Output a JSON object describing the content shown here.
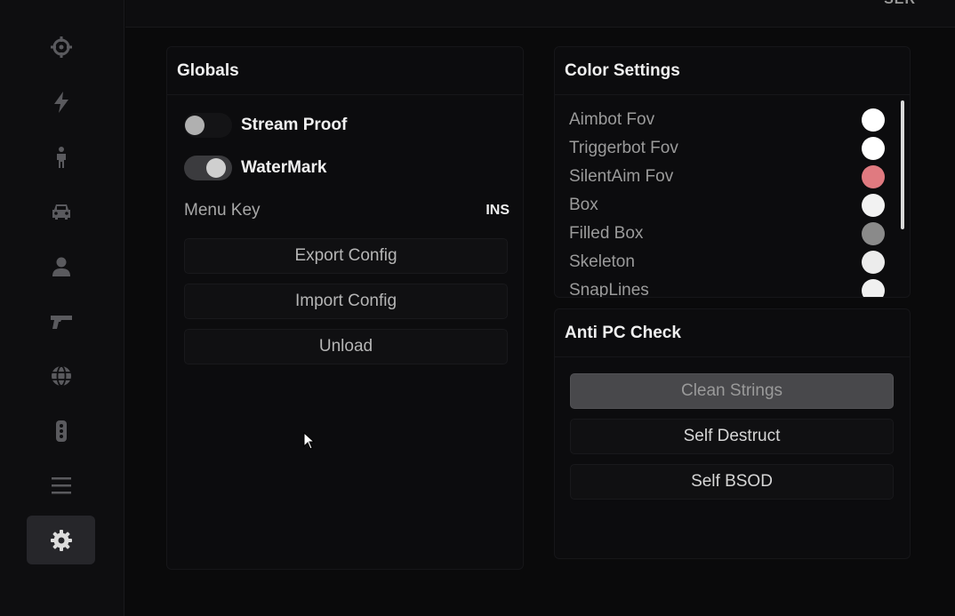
{
  "topbar": {
    "text": "SER"
  },
  "sidebar": {
    "items": [
      {
        "icon": "crosshair-icon",
        "name": "aimbot"
      },
      {
        "icon": "lightning-icon",
        "name": "triggerbot"
      },
      {
        "icon": "person-standing-icon",
        "name": "player"
      },
      {
        "icon": "car-icon",
        "name": "vehicle"
      },
      {
        "icon": "user-icon",
        "name": "user"
      },
      {
        "icon": "gun-icon",
        "name": "weapon"
      },
      {
        "icon": "globe-icon",
        "name": "world"
      },
      {
        "icon": "traffic-light-icon",
        "name": "traffic"
      },
      {
        "icon": "menu-icon",
        "name": "list"
      },
      {
        "icon": "gear-icon",
        "name": "settings",
        "active": true
      }
    ]
  },
  "globals": {
    "title": "Globals",
    "stream_proof": {
      "label": "Stream Proof",
      "enabled": false
    },
    "watermark": {
      "label": "WaterMark",
      "enabled": true
    },
    "menu_key": {
      "label": "Menu Key",
      "value": "INS"
    },
    "export_label": "Export Config",
    "import_label": "Import Config",
    "unload_label": "Unload"
  },
  "color_settings": {
    "title": "Color Settings",
    "items": [
      {
        "label": "Aimbot Fov",
        "color": "#ffffff"
      },
      {
        "label": "Triggerbot Fov",
        "color": "#ffffff"
      },
      {
        "label": "SilentAim Fov",
        "color": "#e07a80"
      },
      {
        "label": "Box",
        "color": "#f2f2f2"
      },
      {
        "label": "Filled Box",
        "color": "#8a8a8a"
      },
      {
        "label": "Skeleton",
        "color": "#ececec"
      },
      {
        "label": "SnapLines",
        "color": "#f0f0f0"
      }
    ]
  },
  "anti_pc_check": {
    "title": "Anti PC Check",
    "clean_strings_label": "Clean Strings",
    "self_destruct_label": "Self Destruct",
    "self_bsod_label": "Self BSOD"
  }
}
